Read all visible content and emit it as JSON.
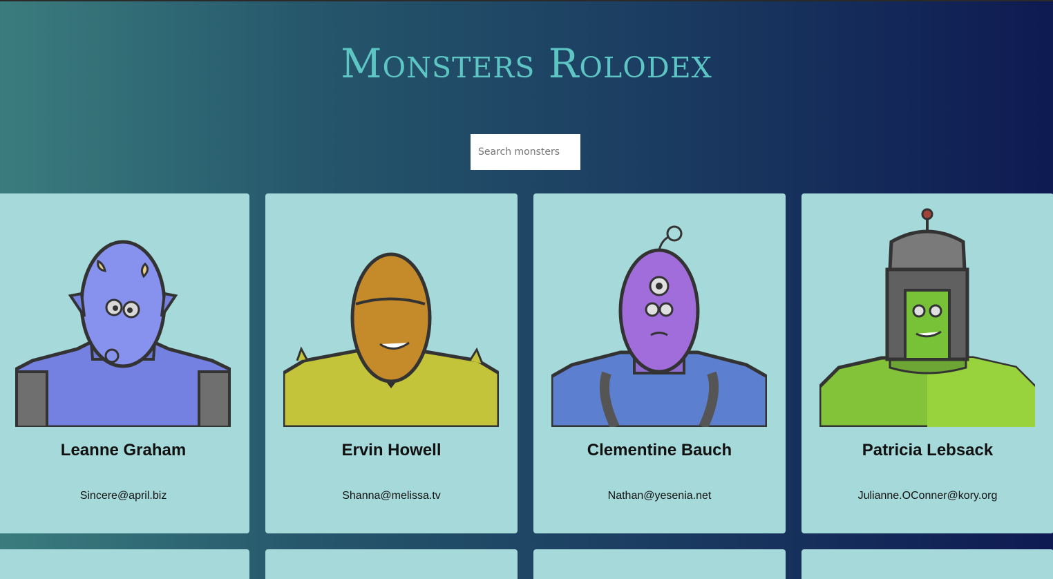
{
  "header": {
    "title": "Monsters Rolodex"
  },
  "search": {
    "placeholder": "Search monsters",
    "value": ""
  },
  "monsters": [
    {
      "name": "Leanne Graham",
      "email": "Sincere@april.biz",
      "avatar": "monster-avatar-blue-horned"
    },
    {
      "name": "Ervin Howell",
      "email": "Shanna@melissa.tv",
      "avatar": "monster-avatar-orange-spiked"
    },
    {
      "name": "Clementine Bauch",
      "email": "Nathan@yesenia.net",
      "avatar": "monster-avatar-purple-cyclops"
    },
    {
      "name": "Patricia Lebsack",
      "email": "Julianne.OConner@kory.org",
      "avatar": "monster-avatar-green-robot"
    }
  ],
  "colors": {
    "title": "#5dc6c4",
    "card": "#a6d9da",
    "gradient_start": "#3a7d7e",
    "gradient_end": "#0e1a52"
  }
}
